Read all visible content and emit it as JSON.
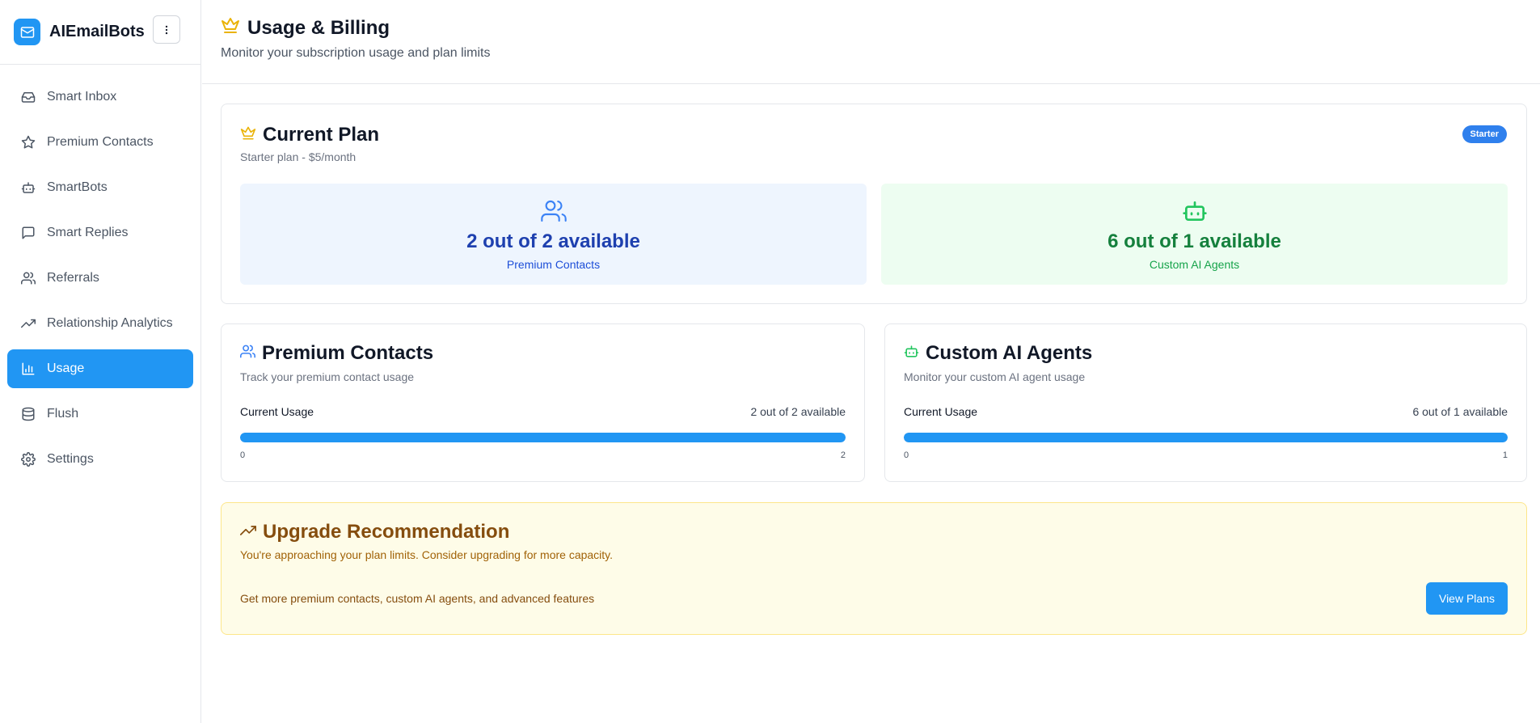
{
  "app": {
    "name": "AIEmailBots"
  },
  "sidebar": {
    "items": [
      {
        "label": "Smart Inbox",
        "icon": "inbox-icon",
        "active": false
      },
      {
        "label": "Premium Contacts",
        "icon": "star-icon",
        "active": false
      },
      {
        "label": "SmartBots",
        "icon": "bot-icon",
        "active": false
      },
      {
        "label": "Smart Replies",
        "icon": "message-square-icon",
        "active": false
      },
      {
        "label": "Referrals",
        "icon": "users-icon",
        "active": false
      },
      {
        "label": "Relationship Analytics",
        "icon": "trending-up-icon",
        "active": false
      },
      {
        "label": "Usage",
        "icon": "bar-chart-icon",
        "active": true
      },
      {
        "label": "Flush",
        "icon": "database-icon",
        "active": false
      },
      {
        "label": "Settings",
        "icon": "gear-icon",
        "active": false
      }
    ]
  },
  "header": {
    "title": "Usage & Billing",
    "subtitle": "Monitor your subscription usage and plan limits"
  },
  "plan": {
    "title": "Current Plan",
    "subtitle": "Starter plan - $5/month",
    "badge": "Starter",
    "contacts_value": "2 out of 2 available",
    "contacts_label": "Premium Contacts",
    "agents_value": "6 out of 1 available",
    "agents_label": "Custom AI Agents"
  },
  "contacts_usage": {
    "title": "Premium Contacts",
    "subtitle": "Track your premium contact usage",
    "usage_label": "Current Usage",
    "usage_value": "2 out of 2 available",
    "min": "0",
    "max": "2",
    "fill_percent": 100
  },
  "agents_usage": {
    "title": "Custom AI Agents",
    "subtitle": "Monitor your custom AI agent usage",
    "usage_label": "Current Usage",
    "usage_value": "6 out of 1 available",
    "min": "0",
    "max": "1",
    "fill_percent": 100
  },
  "upgrade": {
    "title": "Upgrade Recommendation",
    "subtitle": "You're approaching your plan limits. Consider upgrading for more capacity.",
    "text": "Get more premium contacts, custom AI agents, and advanced features",
    "button": "View Plans"
  },
  "colors": {
    "accent": "#2196f3",
    "crown": "#eab308",
    "badge": "#2f80ed",
    "green": "#22c55e",
    "amber": "#854d0e"
  }
}
